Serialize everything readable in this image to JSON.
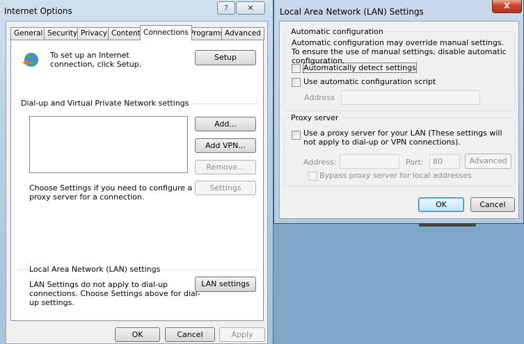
{
  "io": {
    "title": "Internet Options",
    "help_glyph": "?",
    "close_glyph": "✕",
    "tabs": [
      "General",
      "Security",
      "Privacy",
      "Content",
      "Connections",
      "Programs",
      "Advanced"
    ],
    "setup_text": "To set up an Internet connection, click Setup.",
    "setup_button": "Setup",
    "vpn_section": "Dial-up and Virtual Private Network settings",
    "add_button": "Add...",
    "add_vpn_button": "Add VPN...",
    "remove_button": "Remove...",
    "settings_button": "Settings",
    "proxy_hint": "Choose Settings if you need to configure a proxy server for a connection.",
    "lan_section": "Local Area Network (LAN) settings",
    "lan_hint": "LAN Settings do not apply to dial-up connections. Choose Settings above for dial-up settings.",
    "lan_settings_button": "LAN settings",
    "ok": "OK",
    "cancel": "Cancel",
    "apply": "Apply"
  },
  "lan": {
    "title": "Local Area Network (LAN) Settings",
    "close_glyph": "X",
    "auto_group": "Automatic configuration",
    "auto_desc": "Automatic configuration may override manual settings.  To ensure the use of manual settings, disable automatic configuration.",
    "auto_detect": "Automatically detect settings",
    "use_script": "Use automatic configuration script",
    "address_label": "Address",
    "proxy_group": "Proxy server",
    "use_proxy": "Use a proxy server for your LAN (These settings will not apply to dial-up or VPN connections).",
    "proxy_address_label": "Address:",
    "port_label": "Port:",
    "port_value": "80",
    "advanced": "Advanced",
    "bypass": "Bypass proxy server for local addresses",
    "ok": "OK",
    "cancel": "Cancel"
  }
}
